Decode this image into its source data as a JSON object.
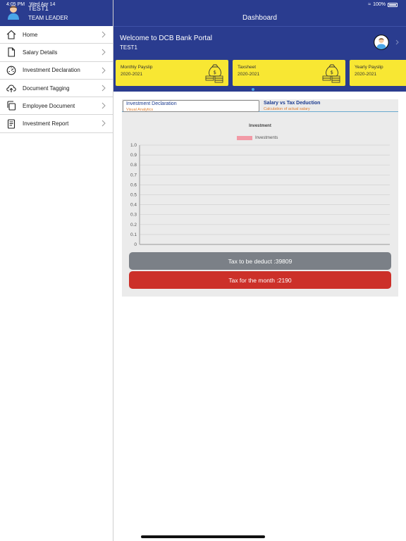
{
  "status": {
    "time": "4:05 PM",
    "date": "Wed Apr 14",
    "battery": "100%"
  },
  "sidebar": {
    "user_name": "TEST1",
    "user_role": "TEAM LEADER",
    "items": [
      {
        "label": "Home",
        "icon": "home-icon"
      },
      {
        "label": "Salary Details",
        "icon": "document-icon"
      },
      {
        "label": "Investment Declaration",
        "icon": "gauge-icon"
      },
      {
        "label": "Document Tagging",
        "icon": "cloud-upload-icon"
      },
      {
        "label": "Employee Document",
        "icon": "copy-icon"
      },
      {
        "label": "Investment Report",
        "icon": "report-icon"
      }
    ]
  },
  "header": {
    "title": "Dashboard"
  },
  "banner": {
    "welcome": "Welcome to DCB Bank Portal",
    "user": "TEST1",
    "cards": [
      {
        "title": "Monthly Payslip",
        "year": "2020-2021"
      },
      {
        "title": "Taxsheet",
        "year": "2020-2021"
      },
      {
        "title": "Yearly Payslip",
        "year": "2020-2021"
      }
    ]
  },
  "tabs": [
    {
      "title": "Investment Declaration",
      "subtitle": "Visual Analytics"
    },
    {
      "title": "Salary vs Tax Deduction",
      "subtitle": "Calculation of actual salary"
    }
  ],
  "chart_data": {
    "type": "bar",
    "title": "Investment",
    "series": [
      {
        "name": "Investments",
        "values": []
      }
    ],
    "categories": [],
    "ylim": [
      0,
      1.0
    ],
    "y_ticks": [
      "0",
      "0.1",
      "0.2",
      "0.3",
      "0.4",
      "0.5",
      "0.6",
      "0.7",
      "0.8",
      "0.9",
      "1.0"
    ],
    "grid": true,
    "legend_position": "top",
    "colors": {
      "series": "#f29aa6"
    }
  },
  "buttons": {
    "tax_deduct": "Tax to be deduct :39809",
    "tax_month": "Tax for the month :2190"
  },
  "colors": {
    "brand": "#2a3c8f",
    "card": "#f8e733",
    "accent_red": "#cc3029",
    "accent_gray": "#7b8087"
  }
}
